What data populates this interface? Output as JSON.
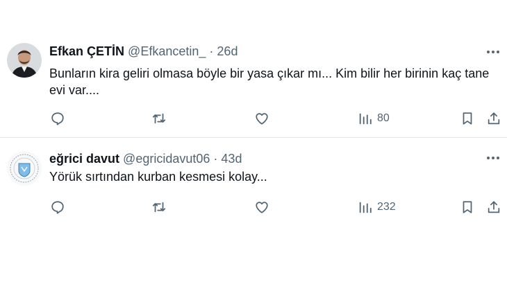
{
  "tweets": [
    {
      "author": "Efkan ÇETİN",
      "handle": "@Efkancetin_",
      "separator": "·",
      "age": "26d",
      "text": "Bunların kira geliri olmasa böyle bir yasa çıkar mı... Kim bilir her birinin kaç tane evi var....",
      "views": "80",
      "avatar_icon": "person-photo-avatar"
    },
    {
      "author": "eğrici davut",
      "handle": "@egricidavut06",
      "separator": "·",
      "age": "43d",
      "text": "Yörük sırtından kurban kesmesi kolay...",
      "views": "232",
      "avatar_icon": "emblem-logo-avatar"
    }
  ],
  "icons": {
    "reply": "speech-bubble-icon",
    "retweet": "retweet-icon",
    "like": "heart-icon",
    "views": "bar-chart-icon",
    "bookmark": "bookmark-icon",
    "share": "share-upload-icon",
    "more": "more-dots-icon"
  },
  "colors": {
    "text": "#0f1419",
    "muted": "#536471",
    "divider": "#e4e8ea"
  }
}
